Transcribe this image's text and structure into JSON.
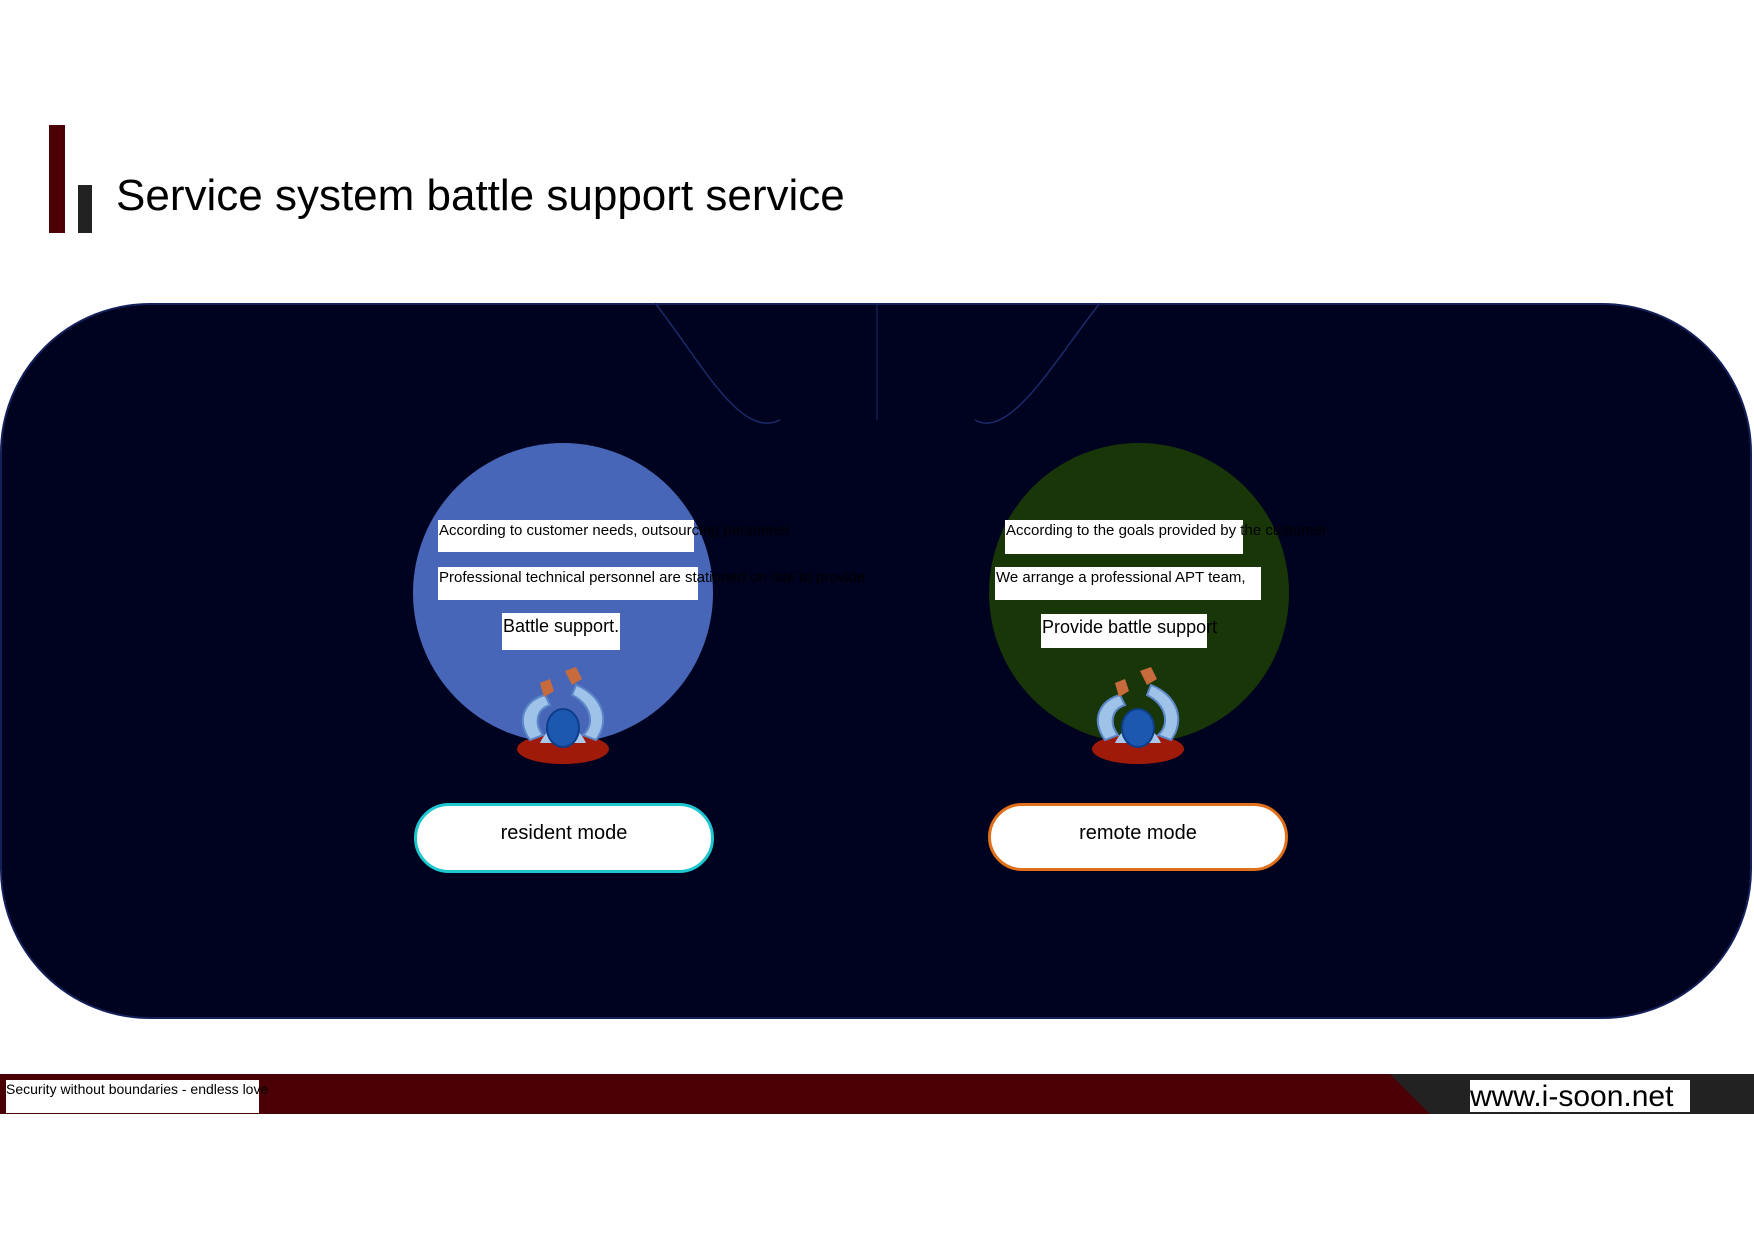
{
  "header": {
    "title": "Service system battle support service"
  },
  "resident": {
    "line1": "According to customer needs, outsourcing personnel",
    "line2": "Professional technical personnel are stationed on-site to provide",
    "line3": "Battle support.",
    "button_label": "resident mode",
    "circle_color": "#4866b8",
    "border_color": "#1cc7d0"
  },
  "remote": {
    "line1": "According to the goals provided by the customer",
    "line2": "We arrange a professional APT team,",
    "line3": "Provide battle support",
    "button_label": "remote mode",
    "circle_color": "#183608",
    "border_color": "#e0701a"
  },
  "footer": {
    "slogan": "Security without boundaries - endless love",
    "url": "www.i-soon.net"
  },
  "colors": {
    "panel_bg": "#00031f",
    "brand_red": "#4a0005",
    "dark": "#222222"
  },
  "icons": [
    "person-raising-hands-icon",
    "person-raising-hands-icon"
  ]
}
